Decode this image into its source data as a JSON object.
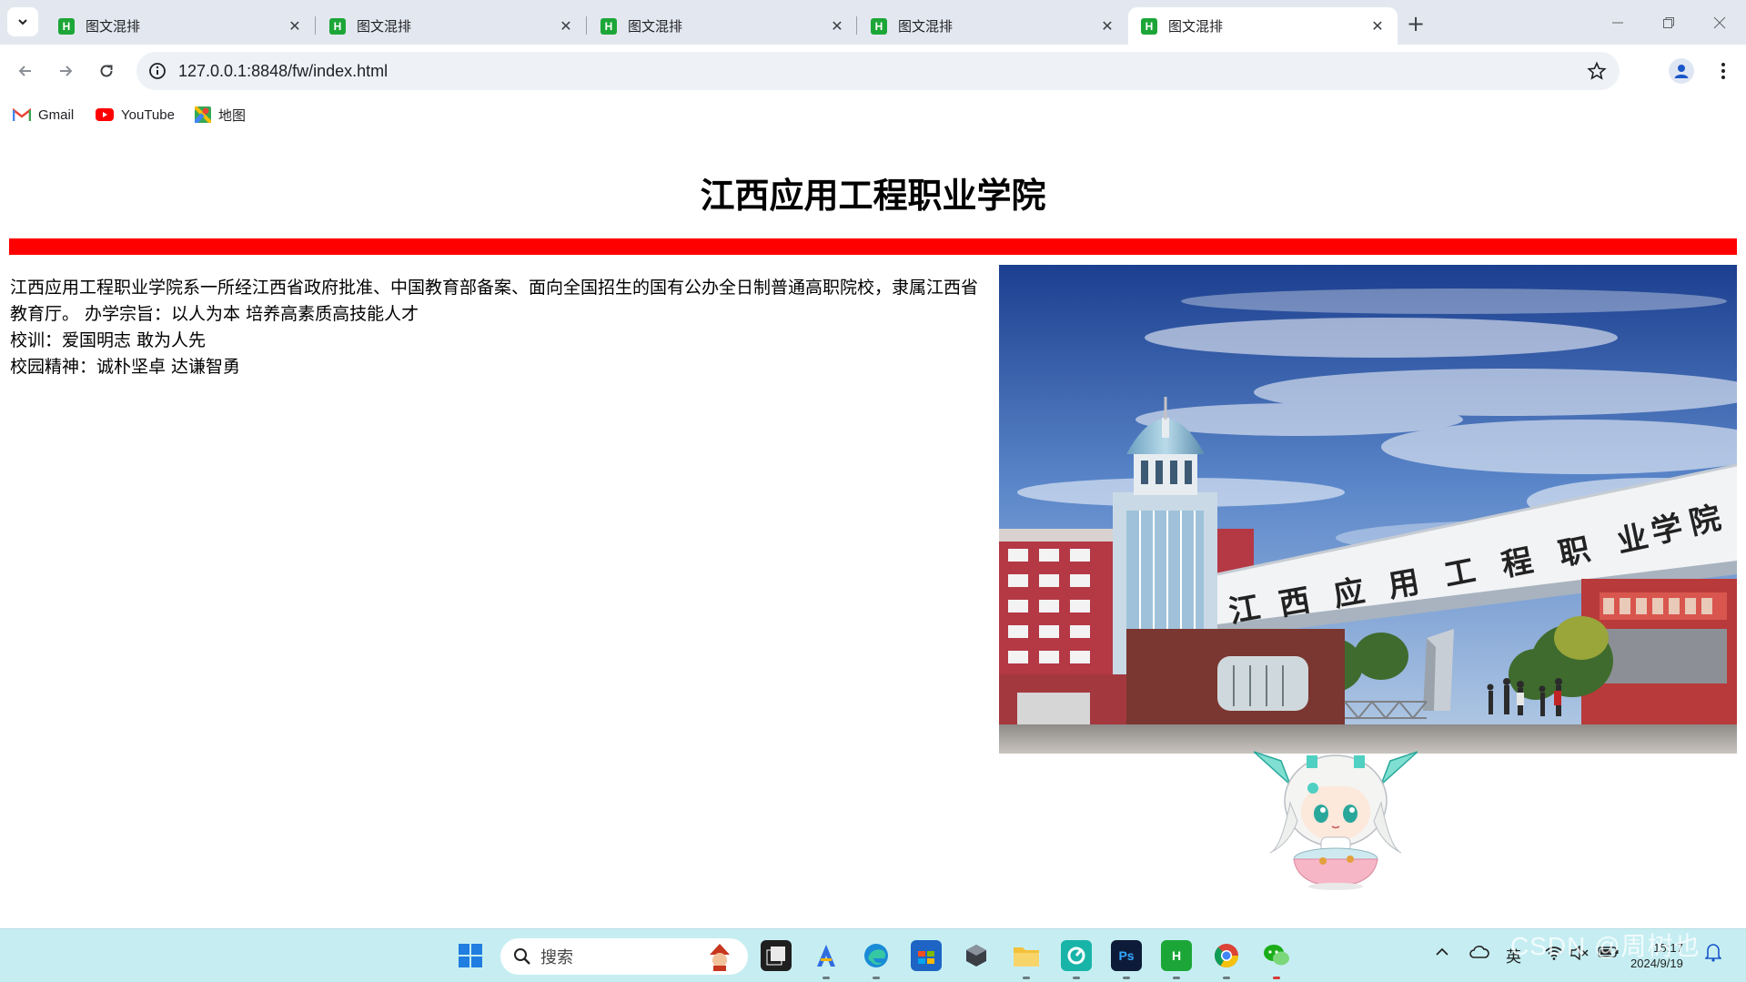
{
  "browser": {
    "tabs": [
      {
        "title": "图文混排",
        "active": false
      },
      {
        "title": "图文混排",
        "active": false
      },
      {
        "title": "图文混排",
        "active": false
      },
      {
        "title": "图文混排",
        "active": false
      },
      {
        "title": "图文混排",
        "active": true
      }
    ],
    "url": "127.0.0.1:8848/fw/index.html",
    "bookmarks": [
      {
        "label": "Gmail",
        "icon": "gmail-icon"
      },
      {
        "label": "YouTube",
        "icon": "youtube-icon"
      },
      {
        "label": "地图",
        "icon": "maps-icon"
      }
    ]
  },
  "page": {
    "heading": "江西应用工程职业学院",
    "accent_color": "#ff0000",
    "intro_text": "江西应用工程职业学院系一所经江西省政府批准、中国教育部备案、面向全国招生的国有公办全日制普通高职院校，隶属江西省教育厅。 办学宗旨：以人为本 培养高素质高技能人才",
    "motto": "校训：爱国明志 敢为人先",
    "spirit": "校园精神：诚朴坚卓 达谦智勇",
    "gate_sign": "江西应用工程职业学院"
  },
  "taskbar": {
    "search_placeholder": "搜索",
    "ime_label": "英",
    "time": "15:17",
    "date": "2024/9/19",
    "watermark": "CSDN @周树也"
  }
}
